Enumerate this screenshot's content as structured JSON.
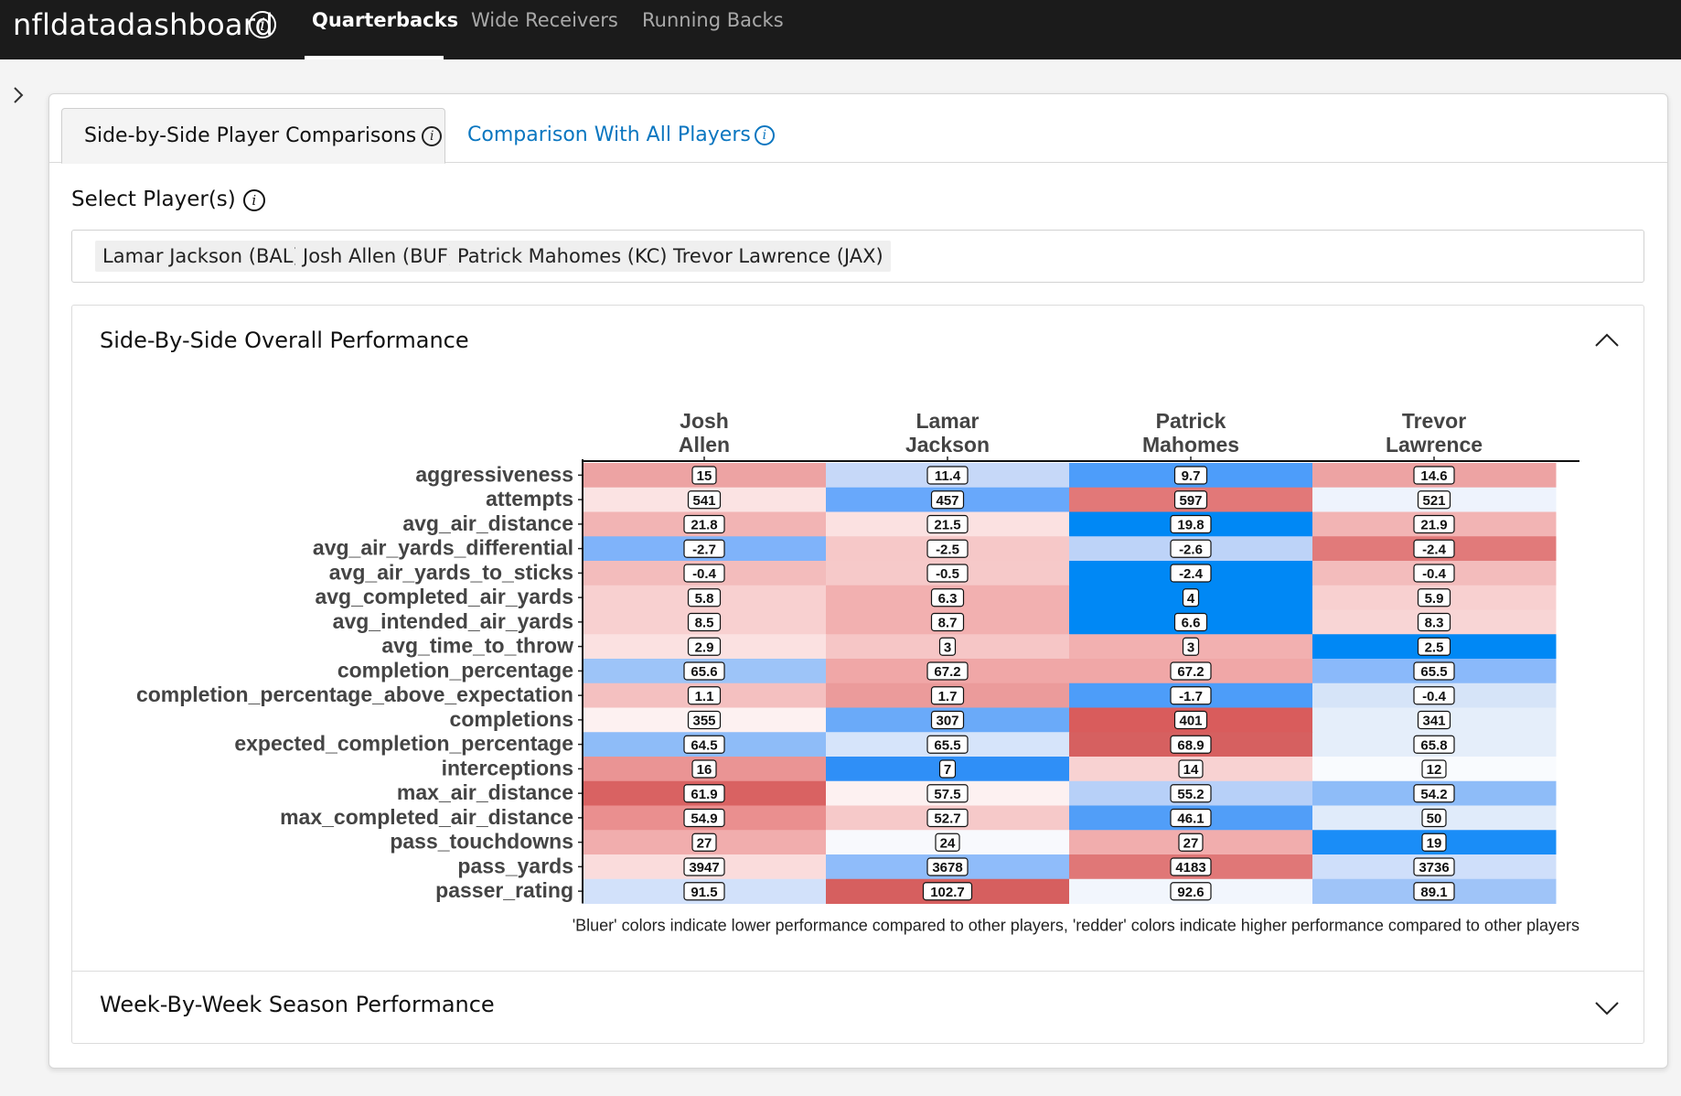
{
  "navbar": {
    "brand": "nfldatadashboard",
    "tabs": [
      "Quarterbacks",
      "Wide Receivers",
      "Running Backs"
    ],
    "active_tab": "Quarterbacks"
  },
  "tabs": {
    "side_by_side": "Side-by-Side Player Comparisons",
    "all_players": "Comparison With All Players"
  },
  "select": {
    "label": "Select Player(s)",
    "chips": [
      "Lamar Jackson (BAL)",
      "Josh Allen (BUF)",
      "Patrick Mahomes (KC)",
      "Trevor Lawrence (JAX)"
    ]
  },
  "accordion": {
    "overall_title": "Side-By-Side Overall Performance",
    "weekly_title": "Week-By-Week Season Performance"
  },
  "icons": {
    "brand_info": "info-icon",
    "sidebar_toggle": "chevron-right-icon",
    "overall_toggle": "chevron-up-icon",
    "weekly_toggle": "chevron-down-icon"
  },
  "chart_data": {
    "type": "heatmap",
    "columns": [
      [
        "Josh",
        "Allen"
      ],
      [
        "Lamar",
        "Jackson"
      ],
      [
        "Patrick",
        "Mahomes"
      ],
      [
        "Trevor",
        "Lawrence"
      ]
    ],
    "rows": [
      "aggressiveness",
      "attempts",
      "avg_air_distance",
      "avg_air_yards_differential",
      "avg_air_yards_to_sticks",
      "avg_completed_air_yards",
      "avg_intended_air_yards",
      "avg_time_to_throw",
      "completion_percentage",
      "completion_percentage_above_expectation",
      "completions",
      "expected_completion_percentage",
      "interceptions",
      "max_air_distance",
      "max_completed_air_distance",
      "pass_touchdowns",
      "pass_yards",
      "passer_rating"
    ],
    "values": [
      [
        "15",
        "11.4",
        "9.7",
        "14.6"
      ],
      [
        "541",
        "457",
        "597",
        "521"
      ],
      [
        "21.8",
        "21.5",
        "19.8",
        "21.9"
      ],
      [
        "-2.7",
        "-2.5",
        "-2.6",
        "-2.4"
      ],
      [
        "-0.4",
        "-0.5",
        "-2.4",
        "-0.4"
      ],
      [
        "5.8",
        "6.3",
        "4",
        "5.9"
      ],
      [
        "8.5",
        "8.7",
        "6.6",
        "8.3"
      ],
      [
        "2.9",
        "3",
        "3",
        "2.5"
      ],
      [
        "65.6",
        "67.2",
        "67.2",
        "65.5"
      ],
      [
        "1.1",
        "1.7",
        "-1.7",
        "-0.4"
      ],
      [
        "355",
        "307",
        "401",
        "341"
      ],
      [
        "64.5",
        "65.5",
        "68.9",
        "65.8"
      ],
      [
        "16",
        "7",
        "14",
        "12"
      ],
      [
        "61.9",
        "57.5",
        "55.2",
        "54.2"
      ],
      [
        "54.9",
        "52.7",
        "46.1",
        "50"
      ],
      [
        "27",
        "24",
        "27",
        "19"
      ],
      [
        "3947",
        "3678",
        "4183",
        "3736"
      ],
      [
        "91.5",
        "102.7",
        "92.6",
        "89.1"
      ]
    ],
    "cell_colors": [
      [
        "#eda3a3",
        "#c6d8f8",
        "#4d9dfa",
        "#eda3a3"
      ],
      [
        "#fbe3e3",
        "#68a8fb",
        "#e27878",
        "#eef3fd"
      ],
      [
        "#f2b4b4",
        "#fbe1e1",
        "#0088f5",
        "#f2b4b4"
      ],
      [
        "#7fb3fa",
        "#f6c8c8",
        "#bdd3f8",
        "#e17a7a"
      ],
      [
        "#f3bcbc",
        "#f6c9c9",
        "#0088f5",
        "#f3bcbc"
      ],
      [
        "#f8d0d0",
        "#f2b0b0",
        "#0088f5",
        "#f8d0d0"
      ],
      [
        "#f8d0d0",
        "#f2b0b0",
        "#0088f5",
        "#f8d5d5"
      ],
      [
        "#fbe1e1",
        "#f6c6c6",
        "#f2b0b0",
        "#0088f5"
      ],
      [
        "#9dc4f8",
        "#f0a7a7",
        "#f0a7a7",
        "#8ab9fa"
      ],
      [
        "#f4c0c0",
        "#eb9b9b",
        "#4d9df9",
        "#d6e4f8"
      ],
      [
        "#fdf1f1",
        "#6aaaf9",
        "#d95c5c",
        "#e5eefa"
      ],
      [
        "#8ebcf8",
        "#d6e4fa",
        "#d66060",
        "#e5eefa"
      ],
      [
        "#ea9494",
        "#2f8ff7",
        "#f8d2d2",
        "#f9fbfe"
      ],
      [
        "#d96262",
        "#fdf1f1",
        "#b7d0f8",
        "#8ebcf8"
      ],
      [
        "#ea8f8f",
        "#f6c9c9",
        "#519ef8",
        "#e0ebfa"
      ],
      [
        "#f1adad",
        "#f8f9fd",
        "#f1adad",
        "#1a8df7"
      ],
      [
        "#fadcdc",
        "#8fbcfa",
        "#e07777",
        "#cfdffa"
      ],
      [
        "#d2e1fa",
        "#d65f5f",
        "#f2f6fd",
        "#9fc4f8"
      ]
    ],
    "caption": "'Bluer' colors indicate lower performance compared to other players, 'redder' colors indicate higher performance compared to other players",
    "legend": "none",
    "grid": false
  }
}
